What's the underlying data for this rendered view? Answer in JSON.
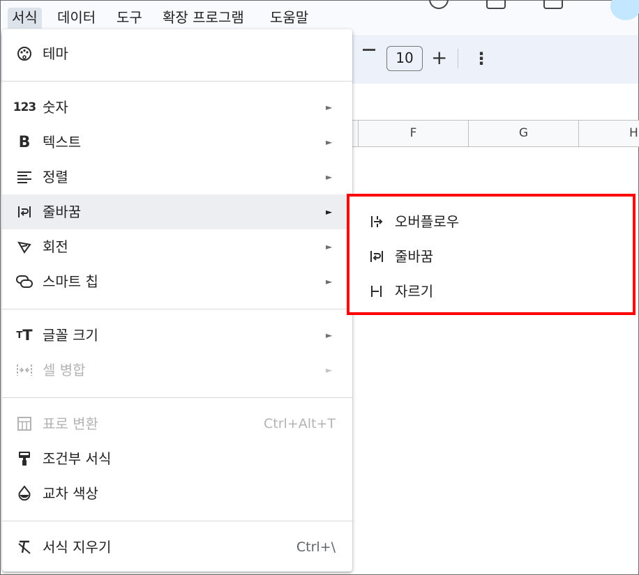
{
  "menubar": {
    "items": [
      {
        "label": "서식",
        "active": true
      },
      {
        "label": "데이터"
      },
      {
        "label": "도구"
      },
      {
        "label": "확장 프로그램"
      },
      {
        "label": "도움말"
      }
    ]
  },
  "toolbar": {
    "font_size": "10",
    "minus_icon": "minus-icon",
    "plus_label": "+",
    "more_label": "⋮"
  },
  "grid": {
    "columns": [
      "F",
      "G",
      "H"
    ]
  },
  "format_menu": {
    "items": [
      {
        "label": "테마",
        "icon": "palette-icon"
      },
      {
        "label": "숫자",
        "icon": "number-123-icon",
        "submenu": true
      },
      {
        "label": "텍스트",
        "icon": "bold-icon",
        "submenu": true
      },
      {
        "label": "정렬",
        "icon": "align-icon",
        "submenu": true
      },
      {
        "label": "줄바꿈",
        "icon": "text-wrap-icon",
        "submenu": true,
        "highlighted": true
      },
      {
        "label": "회전",
        "icon": "text-rotation-icon",
        "submenu": true
      },
      {
        "label": "스마트 칩",
        "icon": "smart-chip-icon",
        "submenu": true
      },
      {
        "label": "글꼴 크기",
        "icon": "font-size-icon",
        "submenu": true
      },
      {
        "label": "셀 병합",
        "icon": "merge-cells-icon",
        "submenu": true,
        "disabled": true
      },
      {
        "label": "표로 변환",
        "icon": "table-icon",
        "shortcut": "Ctrl+Alt+T",
        "disabled": true
      },
      {
        "label": "조건부 서식",
        "icon": "paint-roller-icon"
      },
      {
        "label": "교차 색상",
        "icon": "color-drop-icon"
      },
      {
        "label": "서식 지우기",
        "icon": "clear-format-icon",
        "shortcut": "Ctrl+\\"
      }
    ],
    "submenu_arrow": "►"
  },
  "wrap_submenu": {
    "highlight_color": "#ff0000",
    "items": [
      {
        "label": "오버플로우",
        "icon": "overflow-icon"
      },
      {
        "label": "줄바꿈",
        "icon": "wrap-icon"
      },
      {
        "label": "자르기",
        "icon": "clip-icon"
      }
    ]
  }
}
